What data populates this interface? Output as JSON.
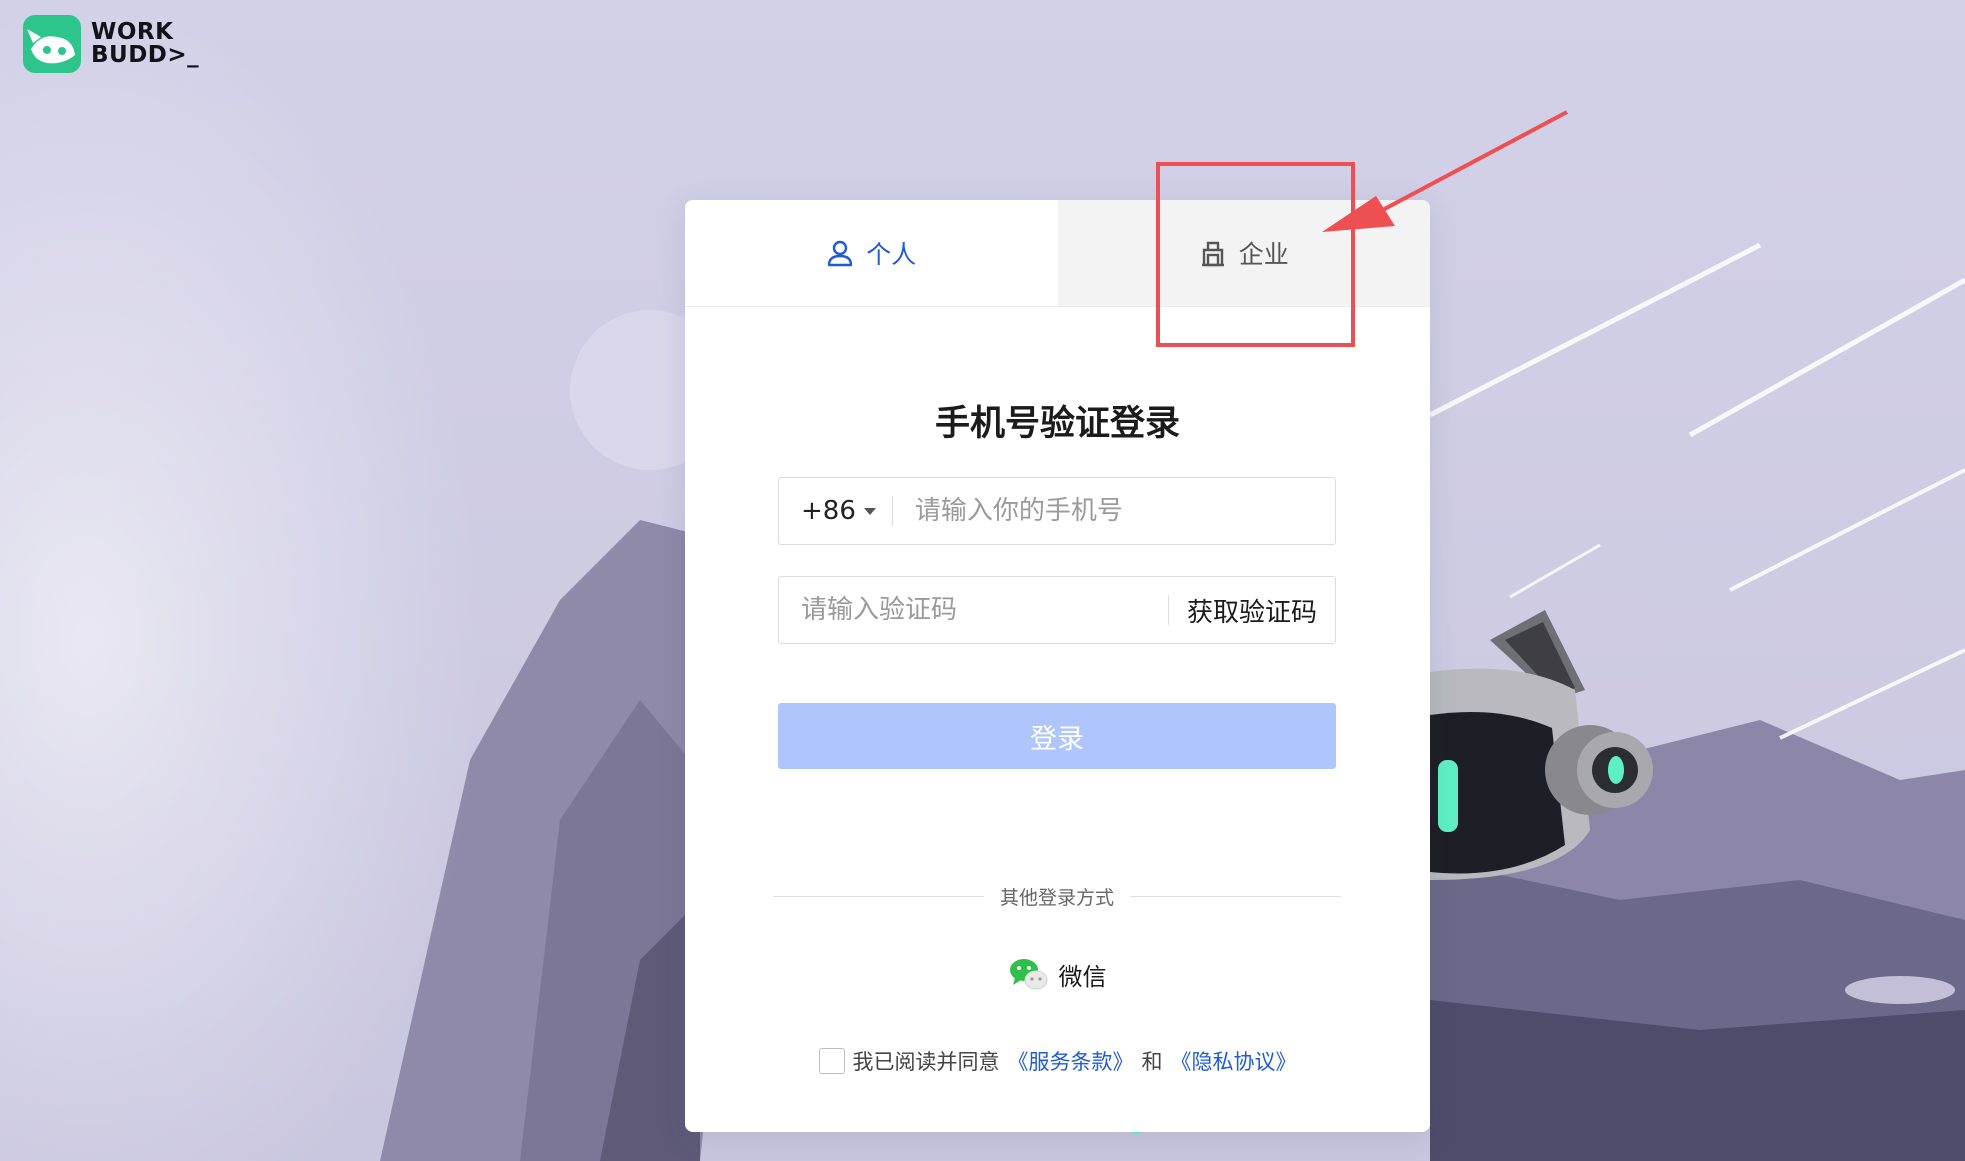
{
  "brand": {
    "line1": "WORK",
    "line2": "BUDD>_"
  },
  "tabs": [
    {
      "label": "个人",
      "icon": "user-icon",
      "active": true
    },
    {
      "label": "企业",
      "icon": "building-icon",
      "active": false
    }
  ],
  "form": {
    "title": "手机号验证登录",
    "country_code": "+86",
    "phone_placeholder": "请输入你的手机号",
    "code_placeholder": "请输入验证码",
    "get_code_label": "获取验证码",
    "login_label": "登录"
  },
  "other_login": {
    "divider_text": "其他登录方式",
    "wechat_label": "微信"
  },
  "agreement": {
    "prefix": "我已阅读并同意",
    "terms_label": "《服务条款》",
    "and": "和",
    "privacy_label": "《隐私协议》"
  },
  "colors": {
    "accent": "#1f5bd8",
    "login_button_disabled": "#aec6fb",
    "annotation": "#ee4f52",
    "background": "#d2d0e6"
  }
}
